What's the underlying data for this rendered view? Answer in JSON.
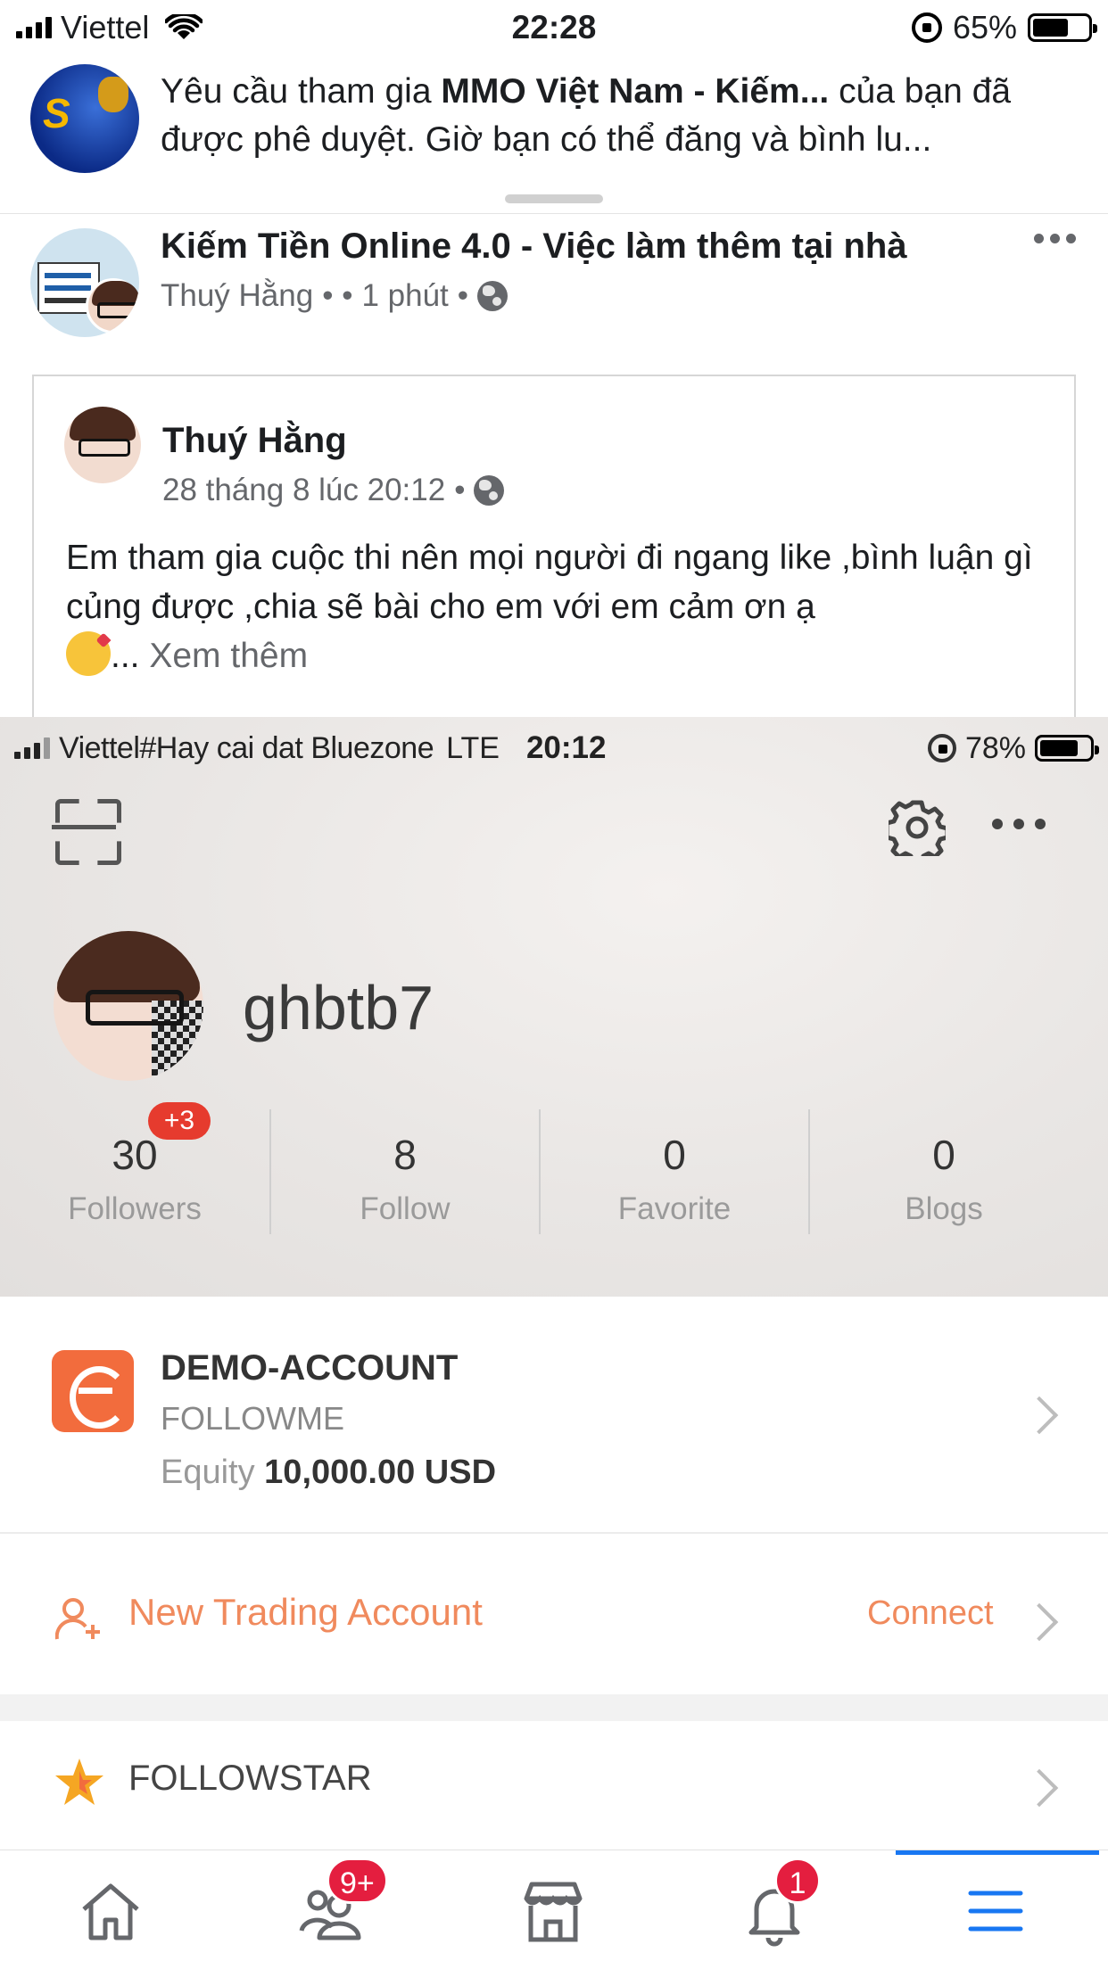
{
  "status_bar": {
    "carrier": "Viettel",
    "time": "22:28",
    "battery": "65%",
    "battery_level": 0.65
  },
  "notification": {
    "text_prefix": "Yêu cầu tham gia ",
    "group_name": "MMO Việt Nam - Kiếm...",
    "text_suffix": " của bạn đã được phê duyệt. Giờ bạn có thể đăng và bình lu..."
  },
  "post": {
    "group_title": "Kiếm Tiền Online 4.0 - Việc làm thêm tại nhà",
    "author": "Thuý Hằng",
    "meta_sep": " •   • ",
    "time": "1 phút",
    "meta_dot": " •"
  },
  "shared_post": {
    "author": "Thuý Hằng",
    "date": "28 tháng 8 lúc 20:12",
    "meta_dot": " •",
    "body": "Em tham gia cuộc thi nên mọi người đi ngang like ,bình luận gì củng được ,chia sẽ bài cho em với em cảm ơn ạ",
    "ellipsis": "...",
    "see_more": " Xem thêm"
  },
  "screenshot": {
    "status": {
      "carrier": "Viettel#Hay cai dat Bluezone",
      "network": "LTE",
      "time": "20:12",
      "battery": "78%",
      "battery_level": 0.78
    },
    "profile": {
      "username": "ghbtb7"
    },
    "stats": [
      {
        "value": "30",
        "label": "Followers",
        "badge": "+3"
      },
      {
        "value": "8",
        "label": "Follow"
      },
      {
        "value": "0",
        "label": "Favorite"
      },
      {
        "value": "0",
        "label": "Blogs"
      }
    ],
    "account": {
      "name": "DEMO-ACCOUNT",
      "broker": "FOLLOWME",
      "equity_label": "Equity ",
      "equity_value": "10,000.00 USD"
    },
    "new_account": {
      "label": "New Trading Account",
      "action": "Connect"
    },
    "followstar": {
      "label": "FOLLOWSTAR"
    },
    "colors": {
      "accent_orange": "#f08a5d",
      "logo_orange": "#f26c3d",
      "badge_red": "#e63b2e"
    }
  },
  "tabbar": {
    "tabs": [
      {
        "icon": "home-icon"
      },
      {
        "icon": "friends-icon",
        "badge": "9+"
      },
      {
        "icon": "marketplace-icon"
      },
      {
        "icon": "bell-icon",
        "badge": "1"
      },
      {
        "icon": "menu-icon",
        "active": true
      }
    ],
    "active_color": "#1877f2",
    "badge_color": "#e41e3f"
  }
}
